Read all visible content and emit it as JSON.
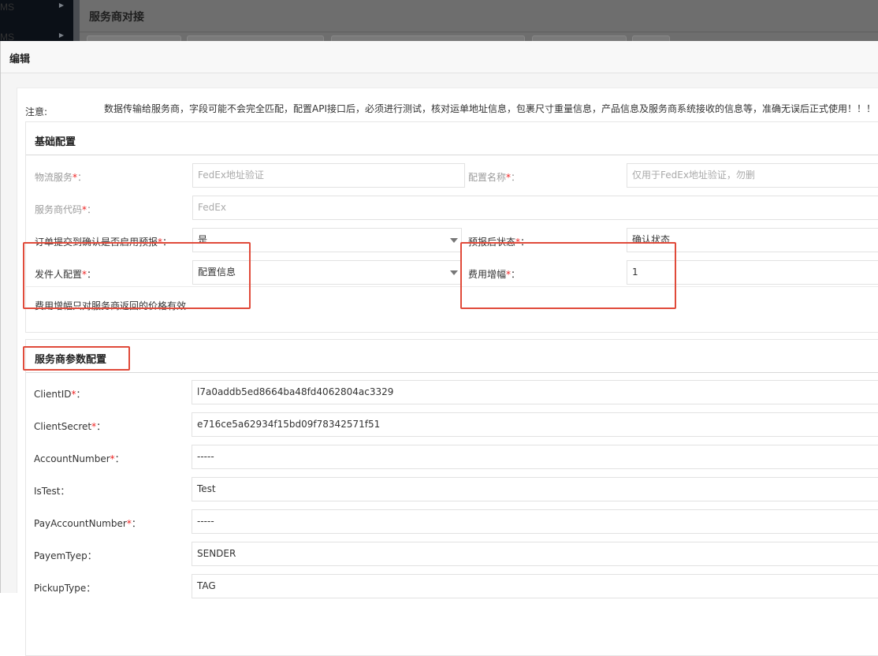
{
  "background": {
    "sidebar_items": [
      {
        "label": "MS"
      },
      {
        "label": "MS"
      }
    ],
    "page_title": "服务商对接"
  },
  "modal": {
    "title": "编辑",
    "notice": {
      "label": "注意:",
      "text": "数据传输给服务商，字段可能不会完全匹配，配置API接口后，必须进行测试，核对运单地址信息，包裹尺寸重量信息，产品信息及服务商系统接收的信息等，准确无误后正式使用！！！"
    },
    "basic": {
      "section_title": "基础配置",
      "logistics_service": {
        "label": "物流服务",
        "colon": "：",
        "value": "FedEx地址验证"
      },
      "config_name": {
        "label": "配置名称",
        "colon": "：",
        "placeholder": "仅用于FedEx地址验证，勿删"
      },
      "provider_code": {
        "label": "服务商代码",
        "colon": "：",
        "value": "FedEx"
      },
      "prereport": {
        "label": "订单提交到确认是否启用预报",
        "colon": "：",
        "value": "是"
      },
      "after_status": {
        "label": "预报后状态",
        "colon": "：",
        "value": "确认状态"
      },
      "sender": {
        "label": "发件人配置",
        "colon": "：",
        "value": "配置信息"
      },
      "fee_increase": {
        "label": "费用增幅",
        "colon": "：",
        "value": "1"
      },
      "fee_note": "费用增幅只对服务商返回的价格有效",
      "required_mark": "*"
    },
    "provider": {
      "section_title": "服务商参数配置",
      "params": [
        {
          "label": "ClientID",
          "required": "*",
          "colon": "：",
          "value": "l7a0addb5ed8664ba48fd4062804ac3329"
        },
        {
          "label": "ClientSecret",
          "required": "*",
          "colon": "：",
          "value": "e716ce5a62934f15bd09f78342571f51"
        },
        {
          "label": "AccountNumber",
          "required": "*",
          "colon": "：",
          "value": "-----"
        },
        {
          "label": "IsTest",
          "required": "",
          "colon": "：",
          "value": "Test"
        },
        {
          "label": "PayAccountNumber",
          "required": "*",
          "colon": "：",
          "value": "-----"
        },
        {
          "label": "PayemTyep",
          "required": "",
          "colon": "：",
          "value": "SENDER"
        },
        {
          "label": "PickupType",
          "required": "",
          "colon": "：",
          "value": "TAG"
        }
      ]
    }
  },
  "colors": {
    "highlight": "#e04a3a",
    "required": "#ee2222",
    "sidebar": "#0b1017",
    "overlay": "#6e6e6e"
  }
}
